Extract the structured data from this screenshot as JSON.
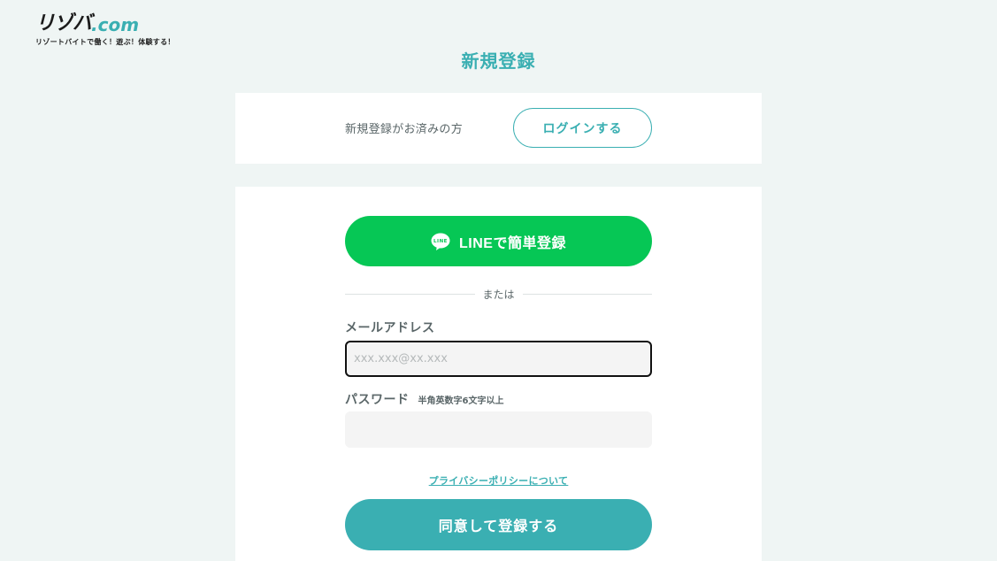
{
  "logo": {
    "kana": "リゾバ",
    "suffix": ".com",
    "tagline": "リゾートバイトで働く！遊ぶ！体験する！"
  },
  "page_title": "新規登録",
  "login_card": {
    "label": "新規登録がお済みの方",
    "button": "ログインする"
  },
  "form": {
    "line_button": "LINEで簡単登録",
    "line_icon_text": "LINE",
    "divider": "または",
    "email_label": "メールアドレス",
    "email_placeholder": "xxx.xxx@xx.xxx",
    "email_value": "",
    "password_label": "パスワード",
    "password_hint": "半角英数字6文字以上",
    "password_value": "",
    "privacy_link": "プライバシーポリシーについて",
    "submit_button": "同意して登録する"
  },
  "colors": {
    "accent": "#3aafb2",
    "line_green": "#06c755",
    "background": "#eff5f4"
  }
}
